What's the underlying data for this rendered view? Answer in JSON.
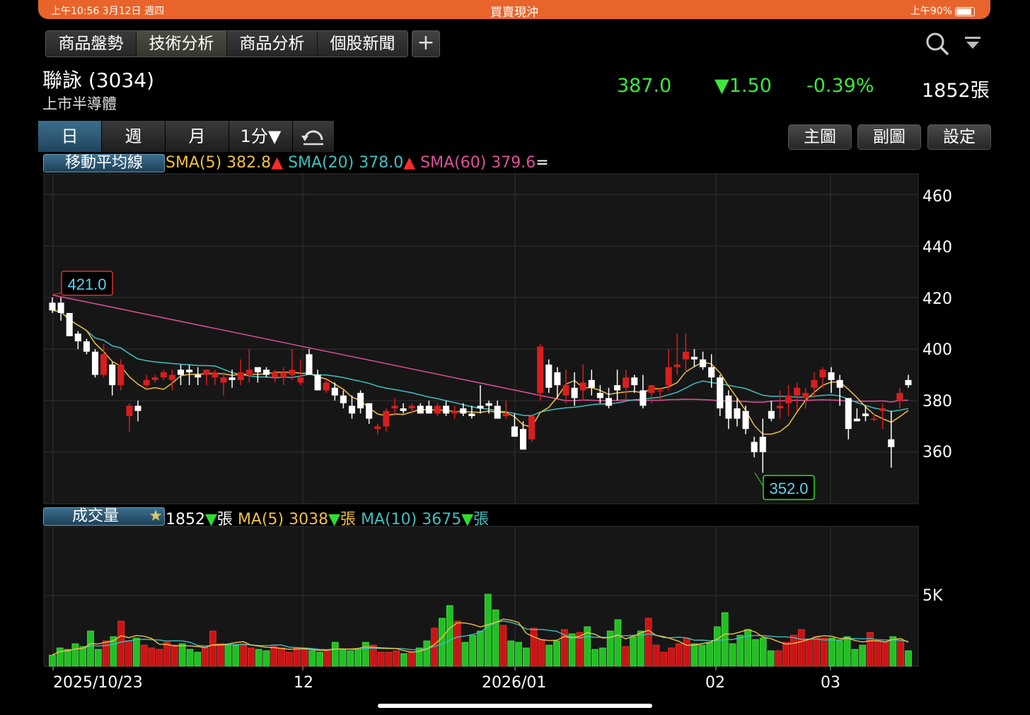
{
  "status_bar": {
    "time": "上午10:56  3月12日 週四",
    "title": "買賣現沖",
    "right": "上午90%"
  },
  "nav_tabs": [
    "商品盤勢",
    "技術分析",
    "商品分析",
    "個股新聞"
  ],
  "add_label": "+",
  "stock": {
    "name": "聯詠 (3034)",
    "sub": "上市半導體",
    "price": "387.0",
    "change": "▼1.50",
    "pct": "-0.39%",
    "volume": "1852張"
  },
  "periods": [
    "日",
    "週",
    "月",
    "1分▼"
  ],
  "right_buttons": [
    "主圖",
    "副圖",
    "設定"
  ],
  "ma_legend": {
    "box": "移動平均線",
    "sma5": "SMA(5) 382.8",
    "sma20": "SMA(20) 378.0",
    "sma60": "SMA(60) 379.6",
    "arrow_up": "▲",
    "eq": "="
  },
  "vol_legend": {
    "box": "成交量",
    "star": "★",
    "vol": "1852",
    "unit": "張",
    "ma5": "MA(5) 3038",
    "ma10": "MA(10) 3675",
    "arrow_down": "▼"
  },
  "colors": {
    "up": "#d81e1e",
    "down": "#ffffff",
    "sma5": "#f0c040",
    "sma20": "#3ec0c0",
    "sma60": "#e0509a",
    "vol_up": "#cc1414",
    "vol_down": "#22c022"
  },
  "chart_data": {
    "type": "candlestick",
    "price_ticks": [
      "460",
      "440",
      "420",
      "400",
      "380",
      "360"
    ],
    "vol_ticks": [
      "5K"
    ],
    "x_ticks": [
      "2025/10/23",
      "12",
      "2026/01",
      "02",
      "03"
    ],
    "high_label": "421.0",
    "low_label": "352.0",
    "ylim": [
      340,
      468
    ],
    "candles": [
      [
        418,
        420,
        414,
        415
      ],
      [
        418,
        420,
        411,
        414
      ],
      [
        414,
        414,
        405,
        405
      ],
      [
        406,
        407,
        400,
        403
      ],
      [
        403,
        404,
        398,
        399
      ],
      [
        399,
        400,
        389,
        390
      ],
      [
        390,
        402,
        389,
        398
      ],
      [
        394,
        395,
        382,
        386
      ],
      [
        386,
        396,
        384,
        394
      ],
      [
        374,
        379,
        368,
        378
      ],
      [
        378,
        380,
        372,
        376
      ],
      [
        386,
        390,
        385,
        388
      ],
      [
        388,
        390,
        387,
        389
      ],
      [
        389,
        392,
        388,
        391
      ],
      [
        388,
        392,
        384,
        390
      ],
      [
        392,
        394,
        386,
        390
      ],
      [
        392,
        394,
        386,
        391
      ],
      [
        390,
        393,
        386,
        389
      ],
      [
        390,
        392,
        386,
        392
      ],
      [
        389,
        392,
        386,
        391
      ],
      [
        387,
        391,
        382,
        389
      ],
      [
        389,
        392,
        385,
        388
      ],
      [
        388,
        396,
        386,
        391
      ],
      [
        390,
        400,
        387,
        392
      ],
      [
        393,
        392,
        387,
        391
      ],
      [
        392,
        393,
        389,
        390
      ],
      [
        389,
        392,
        387,
        391
      ],
      [
        389,
        393,
        386,
        391
      ],
      [
        390,
        400,
        388,
        392
      ],
      [
        387,
        396,
        386,
        389
      ],
      [
        398,
        400,
        390,
        390
      ],
      [
        390,
        392,
        384,
        384
      ],
      [
        384,
        388,
        383,
        387
      ],
      [
        385,
        387,
        380,
        382
      ],
      [
        382,
        384,
        377,
        379
      ],
      [
        378,
        382,
        373,
        375
      ],
      [
        383,
        384,
        375,
        377
      ],
      [
        379,
        379,
        371,
        373
      ],
      [
        369,
        371,
        367,
        370
      ],
      [
        370,
        377,
        368,
        376
      ],
      [
        377,
        381,
        374,
        378
      ],
      [
        377,
        379,
        375,
        376
      ],
      [
        377,
        379,
        375,
        378
      ],
      [
        378,
        379,
        375,
        375
      ],
      [
        378,
        380,
        375,
        375
      ],
      [
        375,
        379,
        374,
        378
      ],
      [
        378,
        380,
        374,
        375
      ],
      [
        375,
        378,
        373,
        376
      ],
      [
        377,
        379,
        374,
        375
      ],
      [
        375,
        378,
        373,
        374
      ],
      [
        378,
        386,
        375,
        377
      ],
      [
        379,
        380,
        375,
        378
      ],
      [
        378,
        380,
        374,
        373
      ],
      [
        374,
        380,
        373,
        375
      ],
      [
        370,
        375,
        366,
        366
      ],
      [
        369,
        372,
        362,
        361
      ],
      [
        365,
        374,
        364,
        374
      ],
      [
        383,
        402,
        380,
        401
      ],
      [
        394,
        396,
        383,
        385
      ],
      [
        391,
        393,
        381,
        386
      ],
      [
        382,
        392,
        379,
        386
      ],
      [
        385,
        391,
        378,
        381
      ],
      [
        384,
        394,
        380,
        387
      ],
      [
        388,
        392,
        382,
        385
      ],
      [
        383,
        386,
        379,
        381
      ],
      [
        381,
        385,
        377,
        378
      ],
      [
        386,
        392,
        380,
        384
      ],
      [
        385,
        392,
        380,
        389
      ],
      [
        389,
        390,
        383,
        386
      ],
      [
        384,
        390,
        377,
        378
      ],
      [
        383,
        386,
        379,
        386
      ],
      [
        384,
        385,
        380,
        384
      ],
      [
        386,
        400,
        384,
        393
      ],
      [
        393,
        406,
        390,
        394
      ],
      [
        396,
        406,
        391,
        399
      ],
      [
        397,
        400,
        393,
        396
      ],
      [
        396,
        399,
        392,
        393
      ],
      [
        393,
        398,
        385,
        389
      ],
      [
        389,
        390,
        374,
        377
      ],
      [
        382,
        384,
        369,
        373
      ],
      [
        377,
        381,
        370,
        373
      ],
      [
        376,
        378,
        367,
        369
      ],
      [
        364,
        366,
        358,
        360
      ],
      [
        366,
        373,
        352,
        360
      ],
      [
        376,
        380,
        372,
        373
      ],
      [
        377,
        384,
        373,
        378
      ],
      [
        379,
        386,
        374,
        382
      ],
      [
        382,
        387,
        376,
        385
      ],
      [
        381,
        385,
        377,
        383
      ],
      [
        385,
        391,
        381,
        388
      ],
      [
        389,
        393,
        385,
        392
      ],
      [
        391,
        393,
        383,
        388
      ],
      [
        388,
        390,
        378,
        385
      ],
      [
        381,
        381,
        365,
        369
      ],
      [
        373,
        377,
        372,
        372
      ],
      [
        375,
        378,
        372,
        374
      ],
      [
        373,
        375,
        372,
        373
      ],
      [
        376,
        379,
        369,
        377
      ],
      [
        365,
        376,
        354,
        362
      ],
      [
        380,
        385,
        377,
        383
      ],
      [
        388,
        390,
        385,
        386
      ]
    ],
    "volumes": [
      800,
      1300,
      1200,
      1600,
      1400,
      2500,
      1200,
      1800,
      2100,
      3200,
      1800,
      2000,
      1500,
      1300,
      1200,
      1700,
      1500,
      1600,
      1200,
      1000,
      1300,
      2500,
      1600,
      1500,
      1500,
      1600,
      1300,
      1200,
      1100,
      1400,
      1300,
      1000,
      1300,
      1200,
      1100,
      1000,
      1100,
      1700,
      1200,
      1100,
      1200,
      1700,
      1500,
      1000,
      1000,
      1100,
      900,
      1000,
      1300,
      1800,
      2700,
      3400,
      4300,
      3200,
      1700,
      2200,
      2500,
      5100,
      4000,
      2900,
      1800,
      1700,
      1300,
      2700,
      1900,
      1500,
      1800,
      2600,
      2300,
      2400,
      2800,
      1200,
      1300,
      2500,
      3300,
      1400,
      2100,
      2500,
      3400,
      1500,
      1000,
      1300,
      1600,
      2000,
      1600,
      1500,
      1700,
      2800,
      3800,
      1600,
      2200,
      2600,
      1900,
      2000,
      1100,
      1100,
      1700,
      2200,
      2600,
      1900,
      2100,
      2000,
      2000,
      1800,
      2100,
      1200,
      1500,
      2400,
      1800,
      1700,
      2100,
      1800,
      1100
    ],
    "vol_max": 5000
  }
}
